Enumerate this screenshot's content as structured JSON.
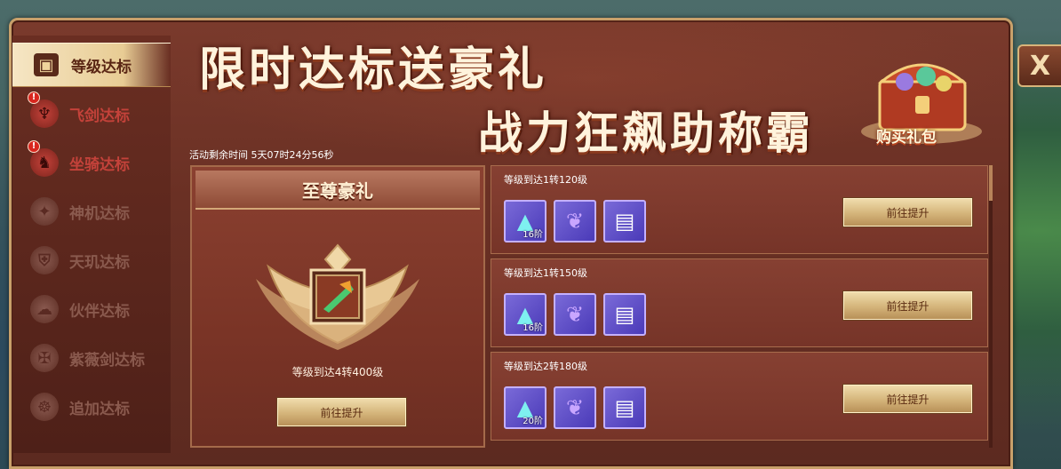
{
  "sidebar": {
    "items": [
      {
        "label": "等级达标",
        "icon": "calendar-icon",
        "active": true,
        "alert": false
      },
      {
        "label": "飞剑达标",
        "icon": "flying-sword-icon",
        "active": false,
        "alert": true
      },
      {
        "label": "坐骑达标",
        "icon": "mount-icon",
        "active": false,
        "alert": true
      },
      {
        "label": "神机达标",
        "icon": "shenji-icon",
        "active": false,
        "alert": false
      },
      {
        "label": "天玑达标",
        "icon": "tianji-icon",
        "active": false,
        "alert": false
      },
      {
        "label": "伙伴达标",
        "icon": "partner-icon",
        "active": false,
        "alert": false
      },
      {
        "label": "紫薇剑达标",
        "icon": "ziwei-sword-icon",
        "active": false,
        "alert": false
      },
      {
        "label": "追加达标",
        "icon": "extra-icon",
        "active": false,
        "alert": false
      }
    ],
    "alert_mark": "!"
  },
  "banner": {
    "line1": "限时达标送豪礼",
    "line2": "战力狂飙助称霸",
    "chest_label": "购买礼包"
  },
  "close_label": "X",
  "timer": "活动剩余时间  5天07时24分56秒",
  "gift": {
    "title": "至尊豪礼",
    "requirement": "等级到达4转400级",
    "button_label": "前往提升"
  },
  "tasks": [
    {
      "requirement": "等级到达1转120级",
      "button_label": "前往提升",
      "items": [
        {
          "icon": "boots-icon",
          "level": "16阶"
        },
        {
          "icon": "wing-icon",
          "level": ""
        },
        {
          "icon": "card-icon",
          "level": ""
        }
      ]
    },
    {
      "requirement": "等级到达1转150级",
      "button_label": "前往提升",
      "items": [
        {
          "icon": "armor-icon",
          "level": "16阶"
        },
        {
          "icon": "wing-icon",
          "level": ""
        },
        {
          "icon": "card-icon",
          "level": ""
        }
      ]
    },
    {
      "requirement": "等级到达2转180级",
      "button_label": "前往提升",
      "items": [
        {
          "icon": "gauntlet-icon",
          "level": "20阶"
        },
        {
          "icon": "wing-icon",
          "level": ""
        },
        {
          "icon": "card-icon",
          "level": ""
        }
      ]
    }
  ],
  "colors": {
    "panel": "#6a3024",
    "frame_gold": "#c8a06a",
    "alert_red": "#d8261e",
    "alert_text_red": "#c4423a"
  }
}
